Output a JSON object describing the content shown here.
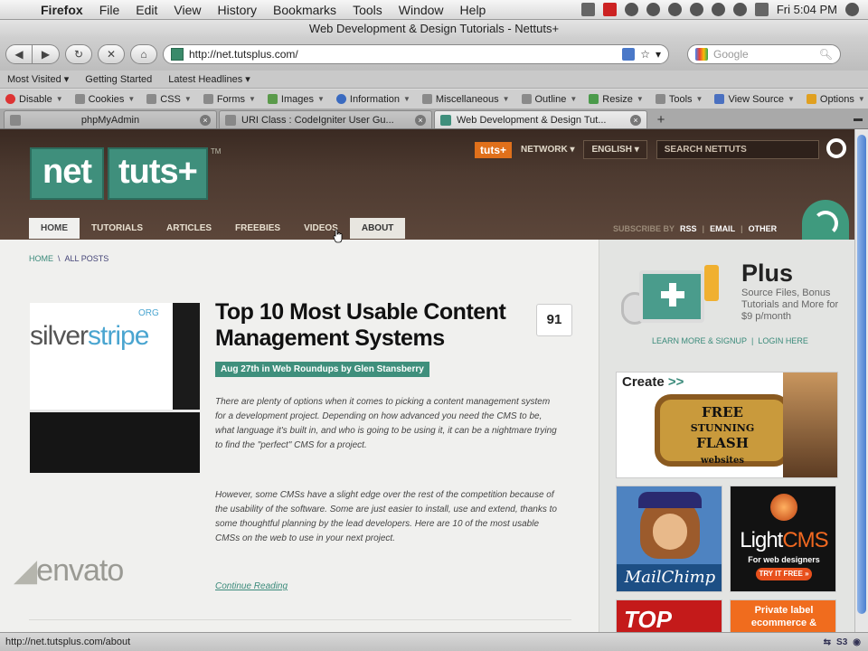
{
  "menubar": {
    "app": "Firefox",
    "menus": [
      "File",
      "Edit",
      "View",
      "History",
      "Bookmarks",
      "Tools",
      "Window",
      "Help"
    ],
    "clock": "Fri 5:04 PM"
  },
  "window": {
    "title": "Web Development & Design Tutorials - Nettuts+"
  },
  "navbar": {
    "url": "http://net.tutsplus.com/",
    "search_placeholder": "Google"
  },
  "bookmarks": [
    "Most Visited ▾",
    "Getting Started",
    "Latest Headlines ▾"
  ],
  "devtoolbar": [
    "Disable",
    "Cookies",
    "CSS",
    "Forms",
    "Images",
    "Information",
    "Miscellaneous",
    "Outline",
    "Resize",
    "Tools",
    "View Source",
    "Options"
  ],
  "tabs": [
    {
      "title": "phpMyAdmin",
      "active": false
    },
    {
      "title": "URI Class : CodeIgniter User Gu...",
      "active": false
    },
    {
      "title": "Web Development & Design Tut...",
      "active": true
    }
  ],
  "site": {
    "logo_net": "net",
    "logo_tuts": "tuts+",
    "logo_tm": "TM",
    "network_badge": "tuts+",
    "network_label": "NETWORK ▾",
    "language": "ENGLISH ▾",
    "search_placeholder": "SEARCH NETTUTS",
    "nav": [
      "HOME",
      "TUTORIALS",
      "ARTICLES",
      "FREEBIES",
      "VIDEOS",
      "ABOUT"
    ],
    "subscribe_label": "SUBSCRIBE BY",
    "subscribe_links": [
      "RSS",
      "EMAIL",
      "OTHER"
    ],
    "breadcrumb": {
      "home": "HOME",
      "sep": "\\",
      "current": "ALL POSTS"
    }
  },
  "post": {
    "image_text_silver": "silver",
    "image_text_stripe": "stripe",
    "image_text_org": "ORG",
    "title": "Top 10 Most Usable Content Management Systems",
    "comments": "91",
    "meta": "Aug 27th in Web Roundups by Glen Stansberry",
    "paragraph1": "There are plenty of options when it comes to picking a content management system for a development project. Depending on how advanced you need the CMS to be, what language it's built in, and who is going to be using it, it can be a nightmare trying to find the \"perfect\" CMS for a project.",
    "paragraph2": "However, some CMSs have a slight edge over the rest of the competition because of the usability of the software. Some are just easier to install, use and extend, thanks to some thoughtful planning by the lead developers. Here are 10 of the most usable CMSs on the web to use in your next project.",
    "read_more": "Continue Reading"
  },
  "watermark": "envato",
  "sidebar": {
    "plus_title": "Plus",
    "plus_desc": "Source Files, Bonus Tutorials and More for $9 p/month",
    "plus_signup": "LEARN MORE & SIGNUP",
    "plus_sep": "|",
    "plus_login": "LOGIN HERE",
    "ad1_create": "Create",
    "ad1_arrows": ">>",
    "ad1_line1": "FREE",
    "ad1_line2": "STUNNING",
    "ad1_line3": "FLASH",
    "ad1_line4": "websites",
    "ad2_label": "MailChimp",
    "ad3_light": "Light",
    "ad3_cms": "CMS",
    "ad3_sub": "For web designers",
    "ad3_try": "TRY IT FREE »",
    "ad4_text": "TOP",
    "ad5_text": "Private label ecommerce &"
  },
  "status": {
    "text": "http://net.tutsplus.com/about"
  },
  "colors": {
    "brand_green": "#3f8f7c",
    "header_brown": "#4d3a30",
    "tuts_orange": "#e0701b"
  }
}
